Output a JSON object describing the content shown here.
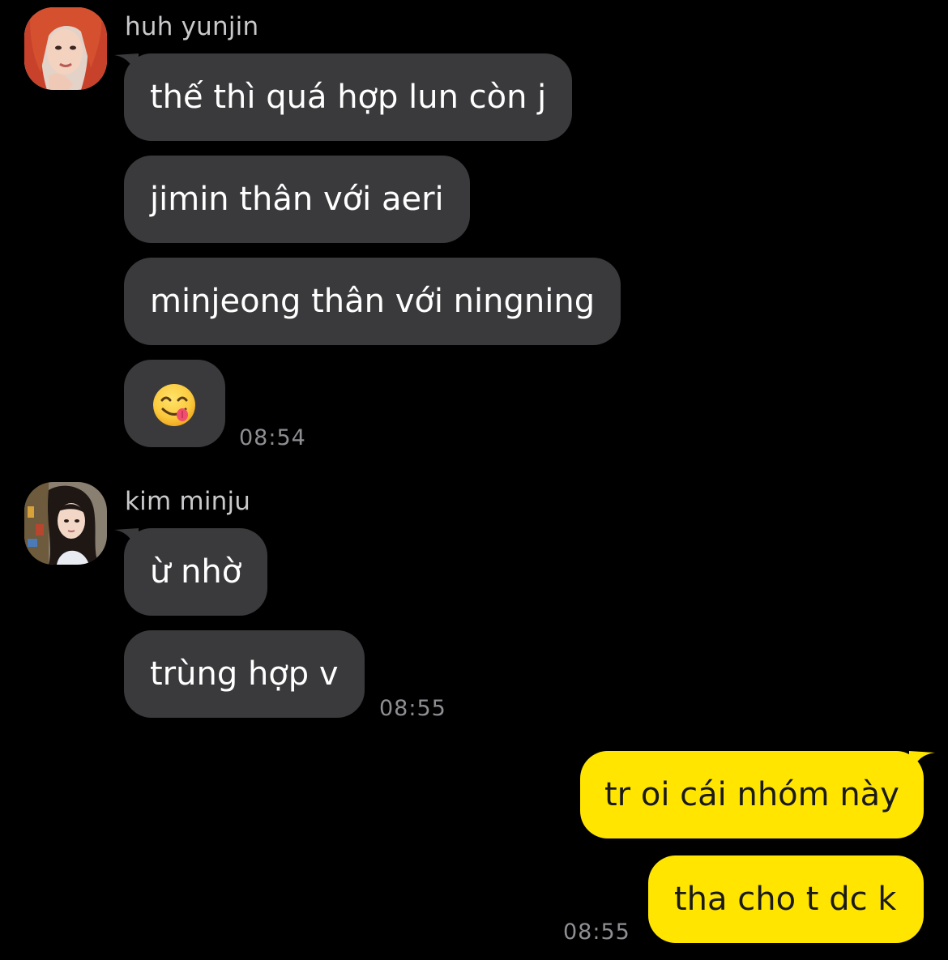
{
  "colors": {
    "background": "#000000",
    "incoming_bubble": "#3a3a3c",
    "outgoing_bubble": "#ffe500",
    "sender_name": "#c9c9cb",
    "timestamp": "#8e8e93"
  },
  "groups": [
    {
      "sender": "huh yunjin",
      "avatar": "profile-photo-red-hair",
      "messages": [
        "thế thì quá hợp lun còn j",
        "jimin thân với aeri",
        "minjeong thân với ningning",
        "😋"
      ],
      "time": "08:54"
    },
    {
      "sender": "kim minju",
      "avatar": "profile-photo-dark-hair",
      "messages": [
        "ừ nhờ",
        "trùng hợp v"
      ],
      "time": "08:55"
    },
    {
      "sender": "",
      "outgoing": true,
      "messages": [
        "tr oi cái nhóm này",
        "tha cho t dc k"
      ],
      "time": "08:55"
    }
  ]
}
